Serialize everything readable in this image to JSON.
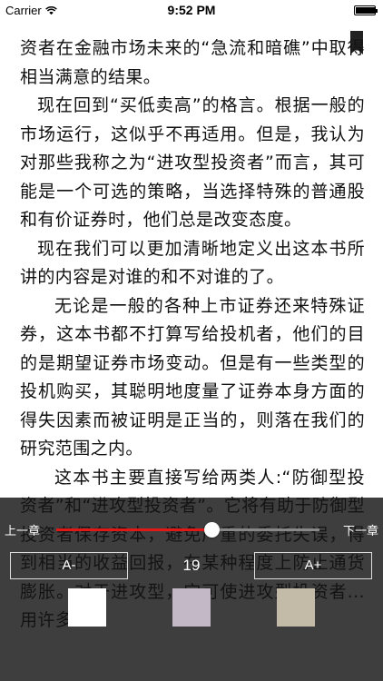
{
  "status_bar": {
    "carrier": "Carrier",
    "time": "9:52 PM",
    "battery_level": 1.0
  },
  "reader": {
    "paragraphs": [
      "资者在金融市场未来的“急流和暗礁”中取得相当满意的结果。",
      "现在回到“买低卖高”的格言。根据一般的市场运行，这似乎不再适用。但是，我认为对那些我称之为“进攻型投资者”而言，其可能是一个可选的策略，当选择特殊的普通股和有价证券时，他们总是改变态度。",
      "现在我们可以更加清晰地定义出这本书所讲的内容是对谁的和不对谁的了。",
      "无论是一般的各种上市证券还来特殊证券，这本书都不打算写给投机者，他们的目的是期望证券市场变动。但是有一些类型的投机购买，其聪明地度量了证券本身方面的得失因素而被证明是正当的，则落在我们的研究范围之内。",
      "这本书主要直接写给两类人:“防御型投资者”和“进攻型投资者”。它将有助于防御型投资者保存资本，避免严重的委托失误，得到相当的收益回报，在某种程度上防止通货膨胀。对于进攻型，它可使进攻型投资者...用许多"
    ]
  },
  "settings_panel": {
    "prev_chapter_label": "上一章",
    "next_chapter_label": "下一章",
    "progress": 0.59,
    "font_decrease_label": "A-",
    "font_size": "19",
    "font_increase_label": "A+",
    "themes": [
      {
        "name": "white",
        "color": "#ffffff"
      },
      {
        "name": "lavender",
        "color": "#c2b8c6"
      },
      {
        "name": "tan",
        "color": "#c4baa8"
      }
    ]
  },
  "colors": {
    "panel_background": "#141414",
    "progress_accent": "#e01818"
  }
}
